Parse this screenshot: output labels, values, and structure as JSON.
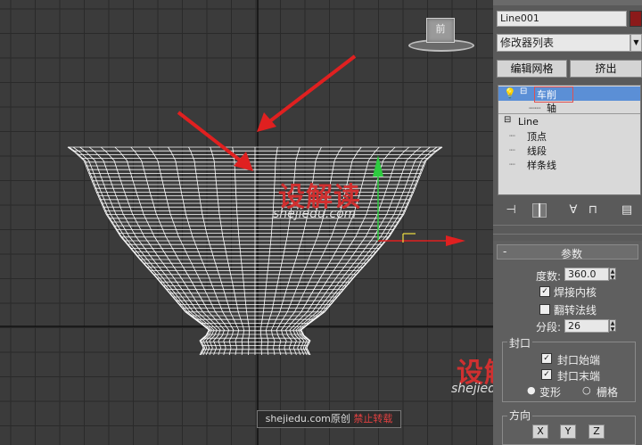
{
  "viewport": {
    "view_cube_label": "前",
    "watermark": {
      "logo_text": "设解读",
      "url": "shejiedu.com",
      "footer_site": "shejiedu.com原创",
      "footer_notice": "禁止转载"
    }
  },
  "command_panel": {
    "object_name": "Line001",
    "object_color": "#8b1a1a",
    "modifier_list": "修改器列表",
    "buttons": {
      "edit_mesh": "编辑网格",
      "extrude": "挤出"
    },
    "stack": {
      "lathe": "车削",
      "axis": "轴",
      "line": "Line",
      "vertex": "顶点",
      "segment": "线段",
      "spline": "样条线"
    },
    "parameters": {
      "title": "参数",
      "degrees_label": "度数:",
      "degrees_value": "360.0",
      "weld_core": "焊接内核",
      "weld_core_checked": true,
      "flip_normals": "翻转法线",
      "flip_normals_checked": false,
      "segments_label": "分段:",
      "segments_value": "26",
      "capping": {
        "title": "封口",
        "cap_start": "封口始端",
        "cap_start_checked": true,
        "cap_end": "封口末端",
        "cap_end_checked": true,
        "morph": "变形",
        "grid": "栅格"
      },
      "direction": {
        "title": "方向",
        "x": "X",
        "y": "Y",
        "z": "Z"
      }
    }
  }
}
